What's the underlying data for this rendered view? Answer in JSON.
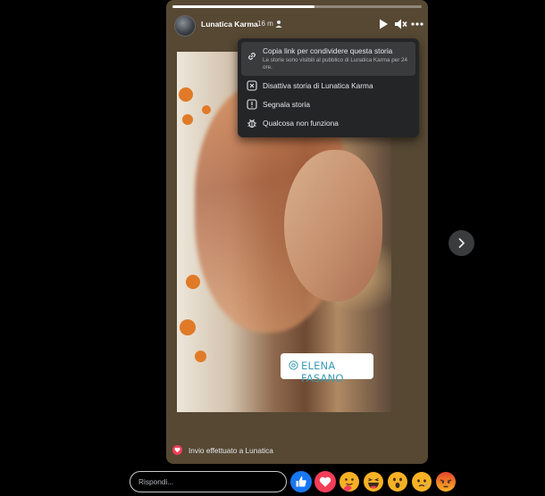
{
  "story": {
    "author": "Lunatica Karma",
    "time": "16 m",
    "progress": 0.57,
    "mention": "ELENA FASANO",
    "sent_notice": "Invio effettuato a Lunatica"
  },
  "menu": {
    "items": [
      {
        "label": "Copia link per condividere questa storia",
        "description": "Le storie sono visibili al pubblico di Lunatica Karma per 24 ore.",
        "icon": "link-icon"
      },
      {
        "label": "Disattiva storia di Lunatica Karma",
        "icon": "close-box-icon"
      },
      {
        "label": "Segnala storia",
        "icon": "report-icon"
      },
      {
        "label": "Qualcosa non funziona",
        "icon": "bug-icon"
      }
    ]
  },
  "reply": {
    "placeholder": "Rispondi..."
  },
  "reactions": [
    "like",
    "love",
    "care",
    "haha",
    "wow",
    "sad",
    "angry"
  ],
  "colors": {
    "menu_bg": "#242526",
    "menu_hover": "#3a3b3c",
    "story_bg": "#564833",
    "like_blue": "#1877f2",
    "love_red": "#f33e58",
    "mention_text": "#3a9ab4"
  }
}
